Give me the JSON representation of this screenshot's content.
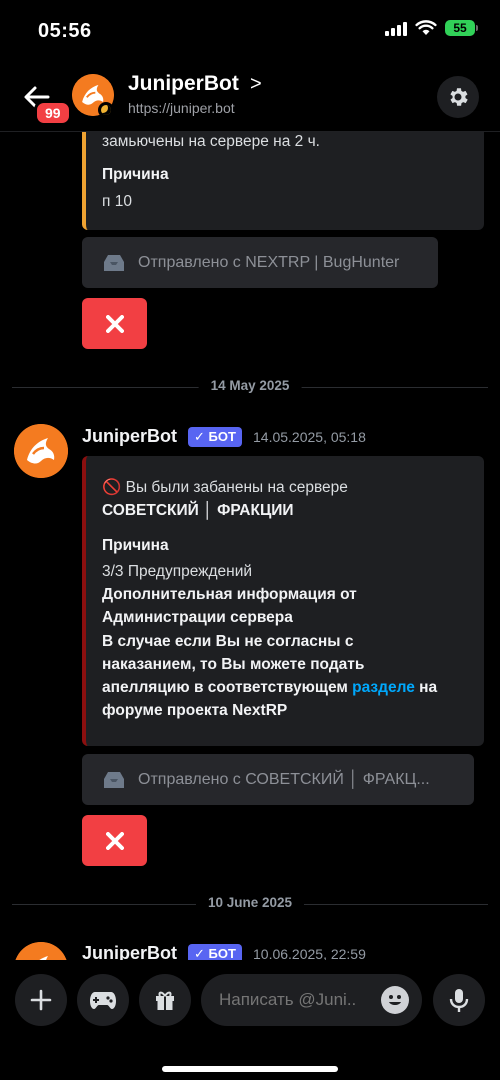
{
  "status": {
    "time": "05:56",
    "battery": "55"
  },
  "header": {
    "unread_badge": "99",
    "title": "JuniperBot",
    "chevron": ">",
    "subtitle": "https://juniper.bot"
  },
  "messages": {
    "msg0": {
      "top_line": "замьючены на сервере на 2 ч.",
      "reason_label": "Причина",
      "reason_value": "п 10",
      "footer": "Отправлено с NEXTRP | BugHunter"
    },
    "divider1": "14 May 2025",
    "msg1": {
      "author": "JuniperBot",
      "bot_badge": "✓ БОТ",
      "timestamp": "14.05.2025, 05:18",
      "title_prefix": "🚫 Вы были забанены на сервере",
      "server_name": "СОВЕТСКИЙ │ ФРАКЦИИ",
      "reason_label": "Причина",
      "reason_value": "3/3 Предупреждений",
      "extra_line1": "Дополнительная информация от",
      "extra_line2": "Администрации сервера",
      "appeal_line1": "В случае если Вы не согласны с",
      "appeal_line2": "наказанием, то Вы можете подать",
      "appeal_line3a": "апелляцию в соответствующем ",
      "appeal_link": "разделе",
      "appeal_line3b": " на",
      "appeal_line4": "форуме проекта NextRP",
      "footer": "Отправлено с СОВЕТСКИЙ │ ФРАКЦ..."
    },
    "divider2": "10 June 2025",
    "msg2": {
      "author": "JuniperBot",
      "bot_badge": "✓ БОТ",
      "timestamp": "10.06.2025, 22:59"
    }
  },
  "composer": {
    "placeholder": "Написать @Juni.."
  },
  "colors": {
    "accent": "#5865f2",
    "danger": "#f23f43",
    "embed_orange": "#f0a332",
    "embed_red": "#8b0f0f",
    "link": "#00a8fc"
  }
}
